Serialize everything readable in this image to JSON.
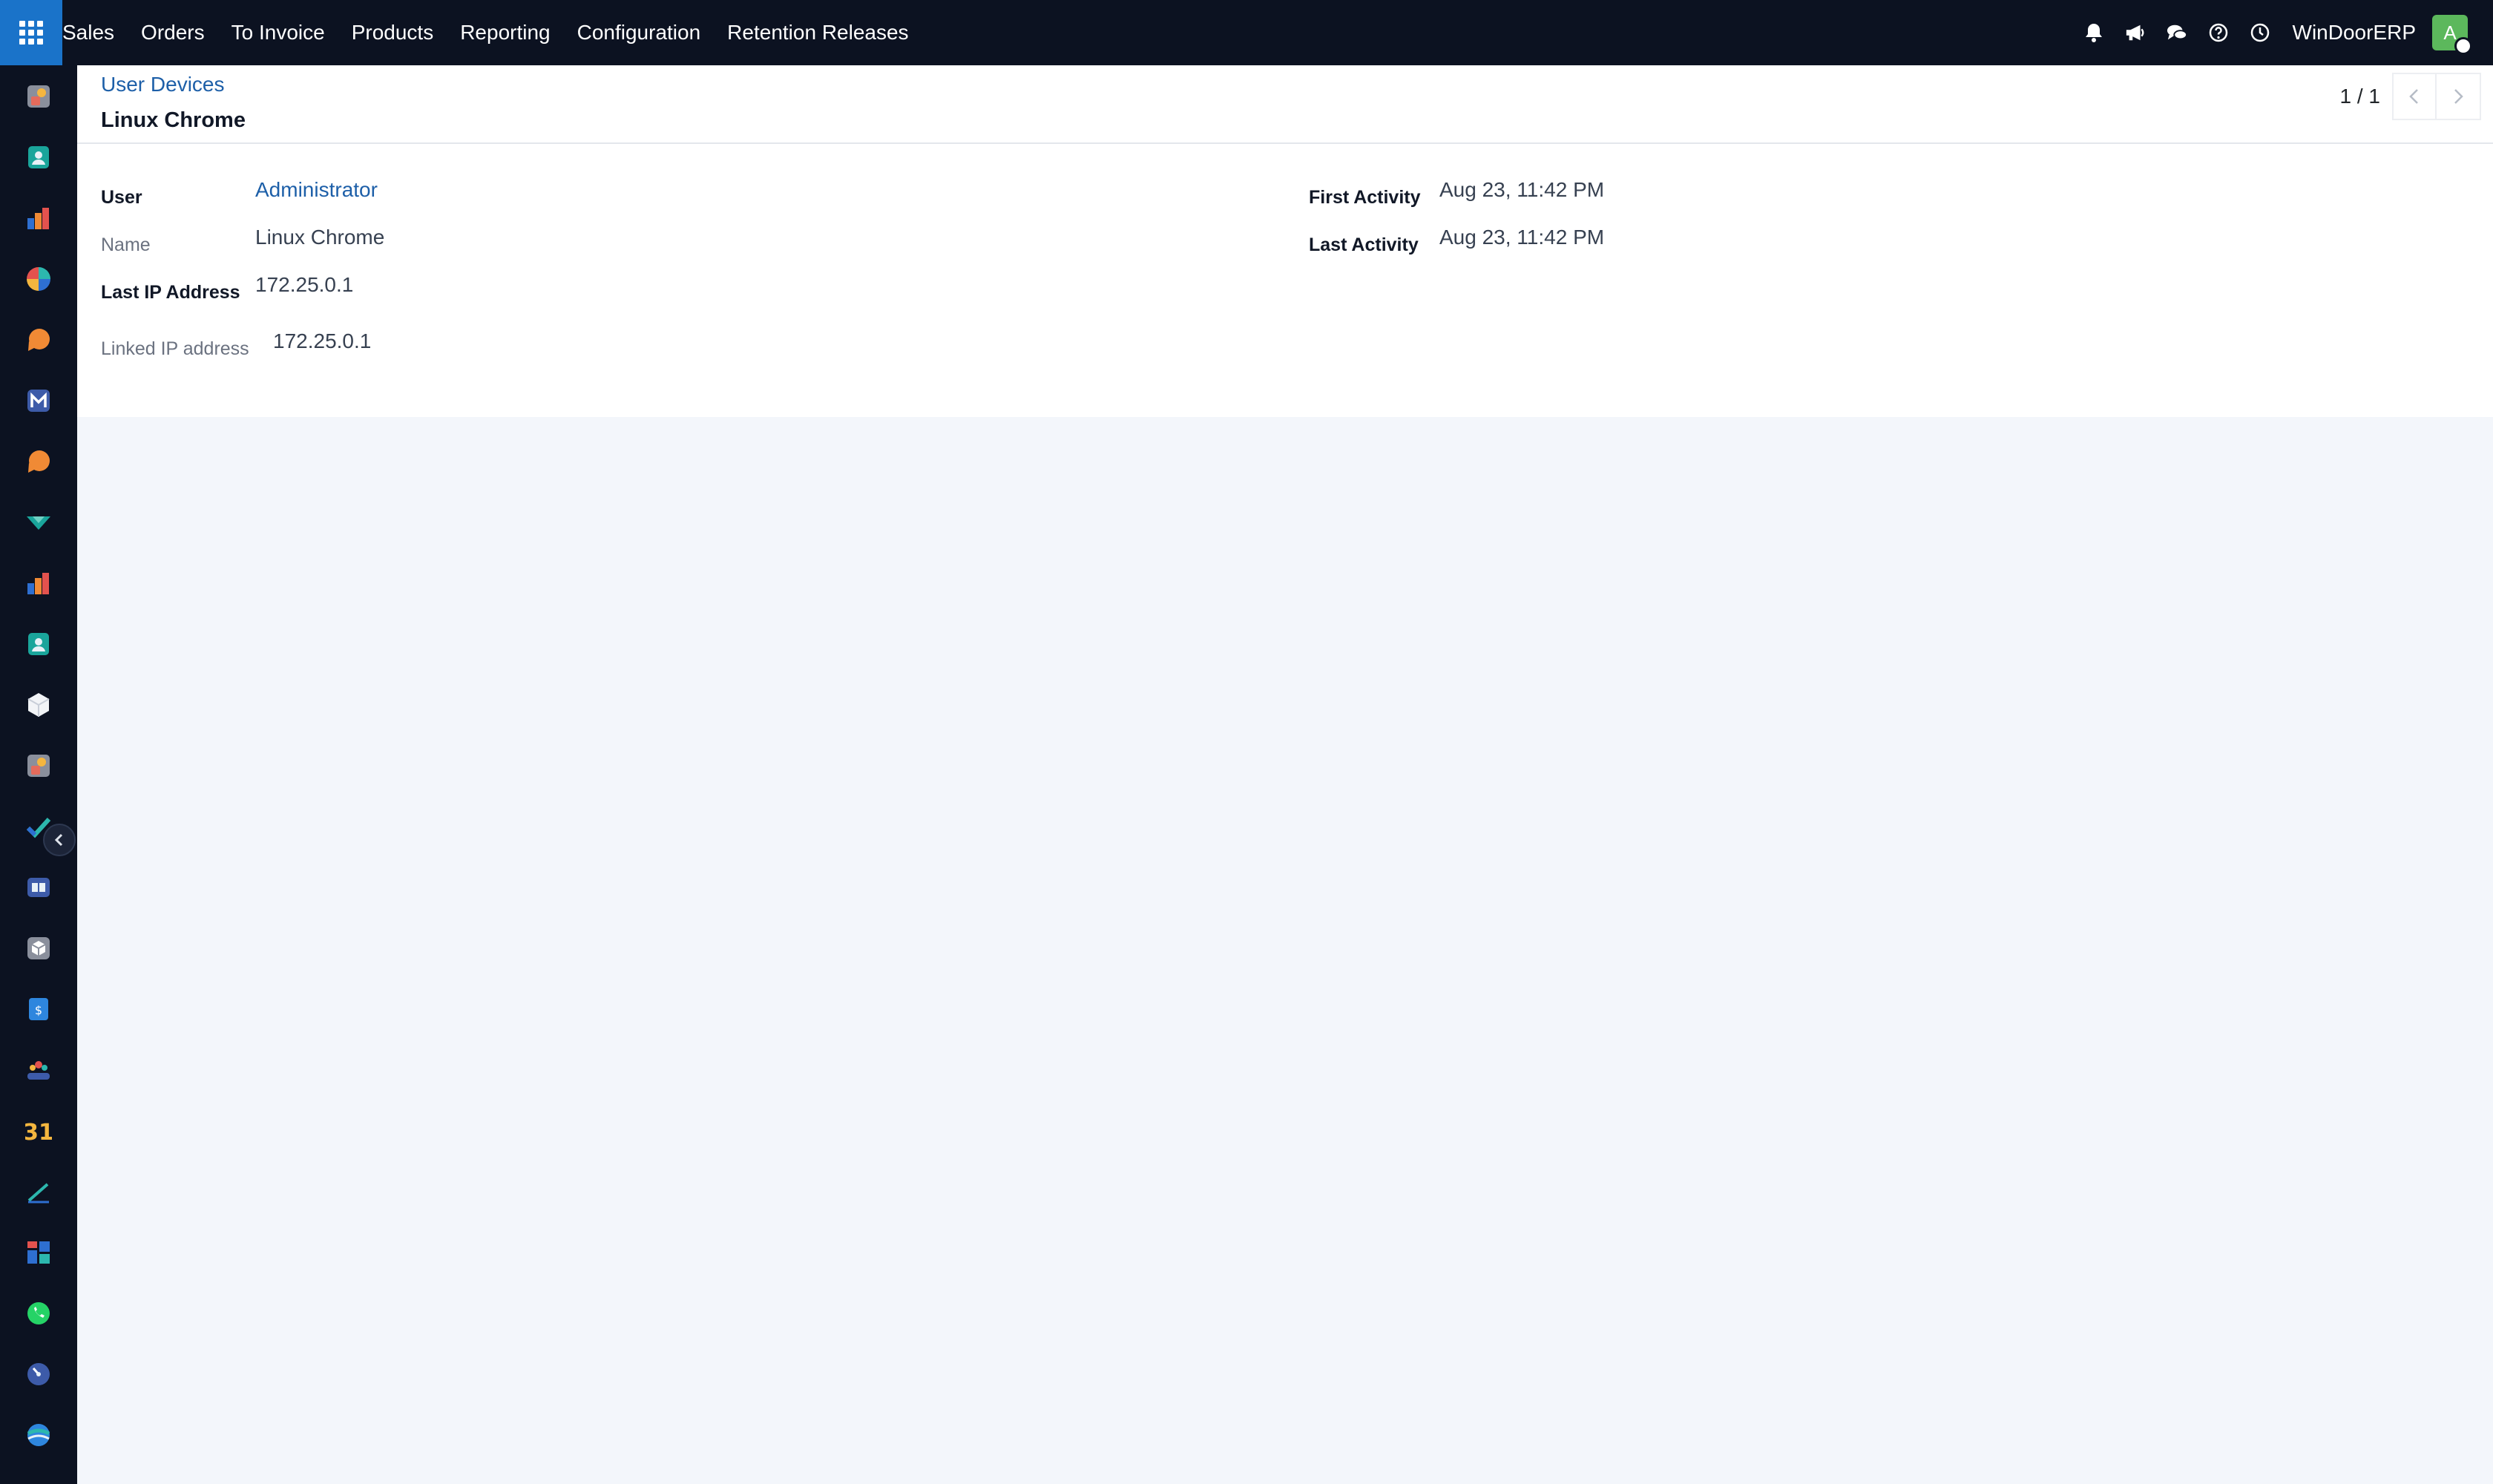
{
  "navbar": {
    "app_menu_icon": "grid-icon",
    "menu": [
      "Sales",
      "Orders",
      "To Invoice",
      "Products",
      "Reporting",
      "Configuration",
      "Retention Releases"
    ],
    "systray_icons": [
      "bell-icon",
      "megaphone-icon",
      "chat-icon",
      "help-icon",
      "clock-icon"
    ],
    "company": "WinDoorERP",
    "avatar_initial": "A",
    "avatar_color": "#5cb85c"
  },
  "sidebar": {
    "icons": [
      "sales-app-icon",
      "contacts-app-icon",
      "reporting-app-icon",
      "dashboard-app-icon",
      "discuss-app-icon",
      "email-marketing-app-icon",
      "livechat-app-icon",
      "project-app-icon",
      "crm-reporting-app-icon",
      "employees-app-icon",
      "inventory-app-icon",
      "sales-app-icon-2",
      "todo-app-icon",
      "knowledge-app-icon",
      "manufacturing-app-icon",
      "invoicing-app-icon",
      "team-app-icon",
      "calendar-app-icon",
      "sign-app-icon",
      "spreadsheet-app-icon",
      "whatsapp-app-icon",
      "timesheet-app-icon",
      "website-app-icon"
    ],
    "calendar_text": "31",
    "collapse_icon": "chevron-left-icon"
  },
  "control_panel": {
    "breadcrumb": "User Devices",
    "title": "Linux Chrome",
    "pager": "1 / 1"
  },
  "form": {
    "user_label": "User",
    "user_value": "Administrator",
    "name_label": "Name",
    "name_value": "Linux Chrome",
    "last_ip_label": "Last IP Address",
    "last_ip_value": "172.25.0.1",
    "linked_ip_label": "Linked IP address",
    "linked_ip_value": "172.25.0.1",
    "first_activity_label": "First Activity",
    "first_activity_value": "Aug 23, 11:42 PM",
    "last_activity_label": "Last Activity",
    "last_activity_value": "Aug 23, 11:42 PM"
  },
  "colors": {
    "navbar_bg": "#0c1221",
    "app_menu_bg": "#1a73c9",
    "link": "#1d5fa8",
    "page_bg": "#f3f6fb"
  }
}
